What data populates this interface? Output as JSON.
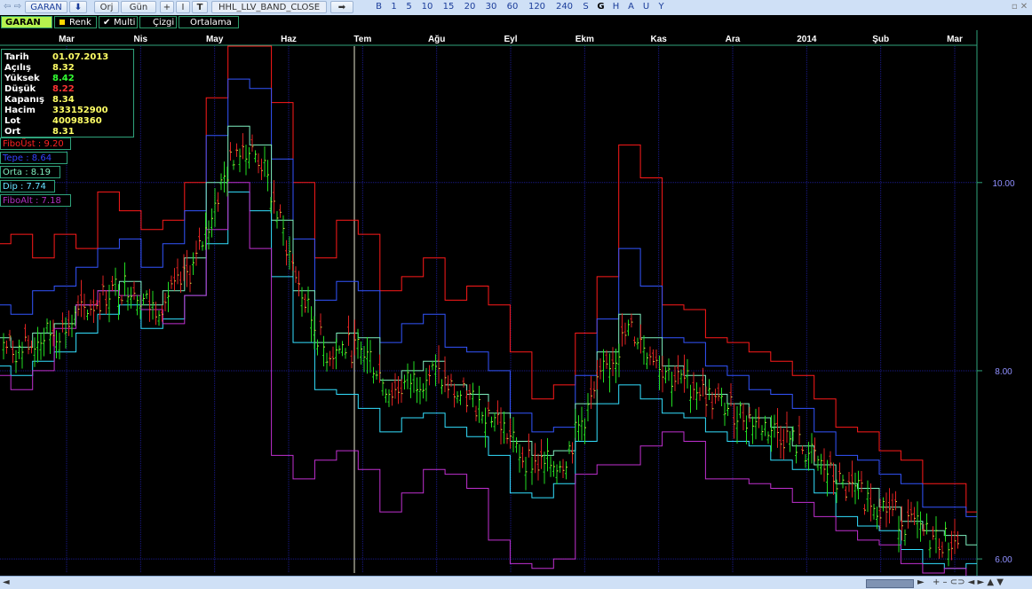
{
  "toolbar": {
    "symbol": "GARAN",
    "orj_label": "Orj",
    "gun_label": "Gün",
    "plus_label": "+",
    "i_label": "I",
    "t_label": "T",
    "formula": "HHL_LLV_BAND_CLOSE",
    "periods": [
      "B",
      "1",
      "5",
      "10",
      "15",
      "20",
      "30",
      "60",
      "120",
      "240",
      "S",
      "G",
      "H",
      "A",
      "U",
      "Y"
    ],
    "active_period": "G"
  },
  "tabs": [
    "GARAN",
    "Renk",
    "Multi",
    "Çizgi",
    "Ortalama"
  ],
  "months": [
    "Mar",
    "Nis",
    "May",
    "Haz",
    "Tem",
    "Ağu",
    "Eyl",
    "Ekm",
    "Kas",
    "Ara",
    "2014",
    "Şub",
    "Mar"
  ],
  "price_axis": [
    "10.00",
    "8.00",
    "6.00"
  ],
  "info": [
    {
      "label": "Tarih",
      "value": "01.07.2013",
      "color": "#ffff66"
    },
    {
      "label": "Açılış",
      "value": "8.32",
      "color": "#ffff66"
    },
    {
      "label": "Yüksek",
      "value": "8.42",
      "color": "#33ff33"
    },
    {
      "label": "Düşük",
      "value": "8.22",
      "color": "#ff3333"
    },
    {
      "label": "Kapanış",
      "value": "8.34",
      "color": "#ffff66"
    },
    {
      "label": "Hacim",
      "value": "333152900",
      "color": "#ffff66"
    },
    {
      "label": "Lot",
      "value": "40098360",
      "color": "#ffff66"
    },
    {
      "label": "Ort",
      "value": "8.31",
      "color": "#ffff66"
    }
  ],
  "legend": [
    {
      "text": "FiboÜst : 9.20",
      "color": "#ff2222"
    },
    {
      "text": "Tepe : 8.64",
      "color": "#3344ff"
    },
    {
      "text": "Orta : 8.19",
      "color": "#7ff0c0"
    },
    {
      "text": "Dip : 7.74",
      "color": "#66e0ff"
    },
    {
      "text": "FiboAlt : 7.18",
      "color": "#b030c0"
    }
  ],
  "chart_data": {
    "type": "line",
    "ylim": [
      5.85,
      11.45
    ],
    "series": [
      {
        "name": "FiboÜst",
        "color": "#ff1a1a",
        "values": [
          9.35,
          9.45,
          9.2,
          9.45,
          9.3,
          9.9,
          9.7,
          9.5,
          9.6,
          10.0,
          10.9,
          11.45,
          11.45,
          10.85,
          10.0,
          9.2,
          9.6,
          9.45,
          8.85,
          9.0,
          9.2,
          8.75,
          8.9,
          8.7,
          8.2,
          7.7,
          7.85,
          8.4,
          9.0,
          10.4,
          10.05,
          8.7,
          8.65,
          8.35,
          8.3,
          8.2,
          8.1,
          7.95,
          7.7,
          7.4,
          7.35,
          7.15,
          7.05,
          6.8,
          6.8,
          6.5
        ]
      },
      {
        "name": "Tepe",
        "color": "#3355ff",
        "values": [
          8.7,
          8.6,
          8.85,
          8.9,
          9.1,
          9.3,
          9.4,
          9.1,
          9.35,
          9.7,
          10.5,
          11.1,
          11.0,
          10.25,
          9.4,
          8.75,
          8.95,
          8.85,
          8.3,
          8.5,
          8.6,
          8.25,
          8.2,
          8.0,
          7.55,
          7.35,
          7.4,
          7.95,
          8.55,
          9.3,
          8.9,
          8.35,
          8.3,
          8.05,
          7.95,
          7.8,
          7.75,
          7.6,
          7.35,
          7.1,
          7.05,
          6.9,
          6.8,
          6.55,
          6.55,
          6.45
        ]
      },
      {
        "name": "Orta",
        "color": "#7ff0c0",
        "values": [
          8.35,
          8.25,
          8.4,
          8.5,
          8.7,
          8.85,
          8.95,
          8.7,
          8.85,
          9.2,
          10.0,
          10.6,
          10.4,
          9.6,
          8.85,
          8.3,
          8.4,
          8.35,
          7.9,
          8.0,
          8.1,
          7.85,
          7.75,
          7.55,
          7.25,
          7.1,
          7.15,
          7.65,
          8.2,
          8.6,
          8.35,
          8.05,
          7.95,
          7.75,
          7.65,
          7.5,
          7.4,
          7.2,
          7.0,
          6.8,
          6.75,
          6.55,
          6.4,
          6.3,
          6.25,
          6.15
        ]
      },
      {
        "name": "Dip",
        "color": "#33e0ff",
        "values": [
          8.05,
          7.95,
          8.1,
          8.2,
          8.4,
          8.6,
          8.7,
          8.45,
          8.55,
          8.8,
          9.35,
          9.9,
          9.7,
          9.0,
          8.3,
          7.8,
          7.75,
          7.6,
          7.35,
          7.5,
          7.55,
          7.4,
          7.3,
          7.1,
          6.7,
          6.65,
          6.8,
          7.25,
          7.65,
          7.85,
          7.7,
          7.55,
          7.5,
          7.35,
          7.25,
          7.2,
          7.05,
          6.95,
          6.7,
          6.45,
          6.35,
          6.3,
          6.1,
          5.95,
          5.9,
          5.95
        ]
      },
      {
        "name": "FiboAlt",
        "color": "#c030d0",
        "values": [
          7.95,
          7.8,
          8.0,
          8.45,
          8.7,
          8.85,
          8.8,
          8.65,
          8.5,
          8.8,
          9.5,
          10.0,
          9.3,
          7.1,
          6.85,
          7.05,
          7.15,
          6.95,
          6.5,
          6.7,
          6.95,
          6.9,
          6.75,
          6.2,
          5.95,
          5.9,
          6.0,
          6.9,
          7.0,
          7.0,
          7.2,
          7.35,
          7.25,
          6.85,
          6.85,
          6.8,
          6.75,
          6.6,
          6.45,
          6.3,
          6.2,
          6.15,
          5.95,
          5.85,
          5.9,
          5.75
        ]
      }
    ]
  },
  "status": {
    "left_arrow": "◄",
    "right_arrow": "►",
    "controls": "+  –  ⊂⊃  ◄  ►  ▲  ▼"
  }
}
